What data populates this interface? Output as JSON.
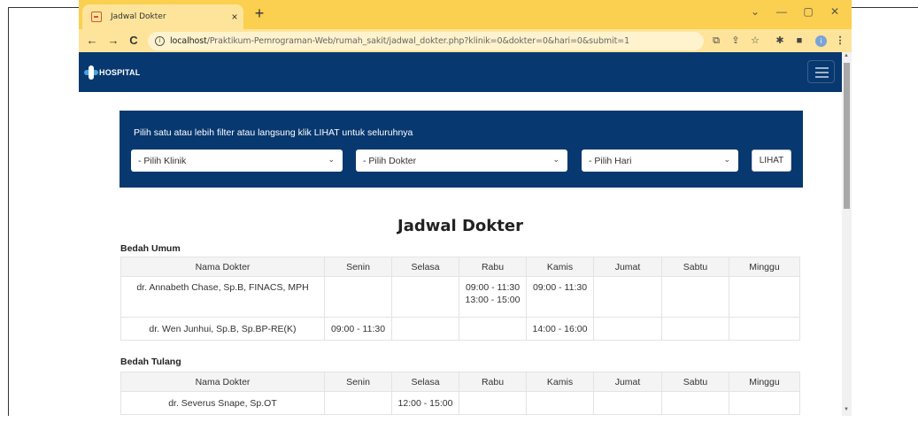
{
  "browser": {
    "tab_title": "Jadwal Dokter",
    "tab_close": "×",
    "new_tab": "+",
    "url_host": "localhost",
    "url_path": "/Praktikum-Pemrograman-Web/rumah_sakit/jadwal_dokter.php?klinik=0&dokter=0&hari=0&submit=1",
    "back": "←",
    "forward": "→",
    "reload": "C",
    "info": "i",
    "profile_initial": "i",
    "window_controls": {
      "collapse": "⌄",
      "minimize": "—",
      "maximize": "▢",
      "close": "✕"
    },
    "toolbar_icons": {
      "translate": "⧉",
      "share": "⇪",
      "star": "☆",
      "extensions": "✱",
      "sidepanel": "■",
      "menu": "⋮"
    }
  },
  "navbar": {
    "brand": "HOSPITAL"
  },
  "filter": {
    "hint": "Pilih satu atau lebih filter atau langsung klik LIHAT untuk seluruhnya",
    "klinik_placeholder": "- Pilih Klinik",
    "dokter_placeholder": "- Pilih Dokter",
    "hari_placeholder": "- Pilih Hari",
    "chevron": "⌄",
    "submit_label": "LIHAT"
  },
  "main": {
    "title": "Jadwal Dokter",
    "columns": [
      "Nama Dokter",
      "Senin",
      "Selasa",
      "Rabu",
      "Kamis",
      "Jumat",
      "Sabtu",
      "Minggu"
    ],
    "sections": [
      {
        "name": "Bedah Umum",
        "rows": [
          {
            "doctor": "dr. Annabeth Chase, Sp.B, FINACS, MPH",
            "senin": "",
            "selasa": "",
            "rabu": "09:00 - 11:30\n13:00 - 15:00",
            "kamis": "09:00 - 11:30",
            "jumat": "",
            "sabtu": "",
            "minggu": ""
          },
          {
            "doctor": "dr. Wen Junhui, Sp.B, Sp.BP-RE(K)",
            "senin": "09:00 - 11:30",
            "selasa": "",
            "rabu": "",
            "kamis": "14:00 - 16:00",
            "jumat": "",
            "sabtu": "",
            "minggu": ""
          }
        ]
      },
      {
        "name": "Bedah Tulang",
        "rows": [
          {
            "doctor": "dr. Severus Snape, Sp.OT",
            "senin": "",
            "selasa": "12:00 - 15:00",
            "rabu": "",
            "kamis": "",
            "jumat": "",
            "sabtu": "",
            "minggu": ""
          }
        ]
      }
    ]
  }
}
